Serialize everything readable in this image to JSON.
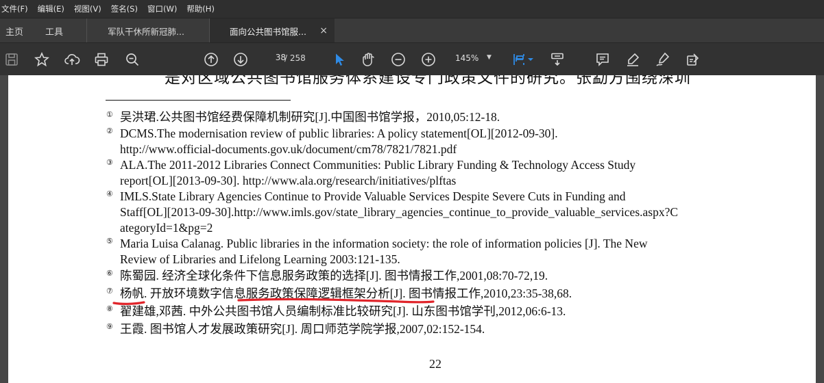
{
  "menu": [
    "文件(F)",
    "编辑(E)",
    "视图(V)",
    "签名(S)",
    "窗口(W)",
    "帮助(H)"
  ],
  "tabs": {
    "home": "主页",
    "tools": "工具",
    "doc1": "军队干休所新冠肺...",
    "doc2": "面向公共图书馆服...",
    "close": "×"
  },
  "toolbar": {
    "page_current": "38",
    "page_total": "/ 258",
    "zoom": "145%",
    "icons": [
      "save-icon",
      "star-icon",
      "upload-cloud-icon",
      "print-icon",
      "search-zoom-icon",
      "page-up-icon",
      "page-down-icon",
      "select-cursor-icon",
      "hand-icon",
      "zoom-out-icon",
      "zoom-in-icon",
      "fit-page-icon",
      "scroll-mode-icon",
      "comment-icon",
      "highlight-pen-icon",
      "sign-icon",
      "fill-sign-icon"
    ],
    "accent": "#2f8be6"
  },
  "document": {
    "body_top_line": "是对区域公共图书馆服务体系建设专门政策文件的研究。张勐方围绕深圳",
    "footnotes": [
      {
        "mark": "①",
        "lines": [
          "吴洪珺.公共图书馆经费保障机制研究[J].中国图书馆学报，2010,05:12-18."
        ]
      },
      {
        "mark": "②",
        "lines": [
          "DCMS.The modernisation review of public libraries: A policy statement[OL][2012-09-30].",
          "http://www.official-documents.gov.uk/document/cm78/7821/7821.pdf"
        ]
      },
      {
        "mark": "③",
        "lines": [
          "ALA.The 2011-2012 Libraries Connect Communities: Public Library Funding & Technology Access Study",
          "report[OL][2013-09-30]. http://www.ala.org/research/initiatives/plftas"
        ]
      },
      {
        "mark": "④",
        "lines": [
          "IMLS.State Library Agencies Continue to Provide Valuable Services Despite Severe Cuts in Funding and",
          "Staff[OL][2013-09-30].http://www.imls.gov/state_library_agencies_continue_to_provide_valuable_services.aspx?C",
          "ategoryId=1&pg=2"
        ]
      },
      {
        "mark": "⑤",
        "lines": [
          "Maria Luisa Calanag. Public libraries in the information society: the role of information policies [J]. The New",
          "Review of Libraries and Lifelong Learning 2003:121-135."
        ]
      },
      {
        "mark": "⑥",
        "lines": [
          "陈蜀园. 经济全球化条件下信息服务政策的选择[J]. 图书情报工作,2001,08:70-72,19."
        ]
      },
      {
        "mark": "⑦",
        "lines": [
          "杨帆. 开放环境数字信息服务政策保障逻辑框架分析[J]. 图书情报工作,2010,23:35-38,68."
        ]
      },
      {
        "mark": "⑧",
        "lines": [
          "翟建雄,邓茜. 中外公共图书馆人员编制标准比较研究[J]. 山东图书馆学刊,2012,06:6-13."
        ]
      },
      {
        "mark": "⑨",
        "lines": [
          "王霞. 图书馆人才发展政策研究[J]. 周口师范学院学报,2007,02:152-154."
        ]
      }
    ],
    "page_number": "22",
    "annotation_color": "#e0242a"
  }
}
